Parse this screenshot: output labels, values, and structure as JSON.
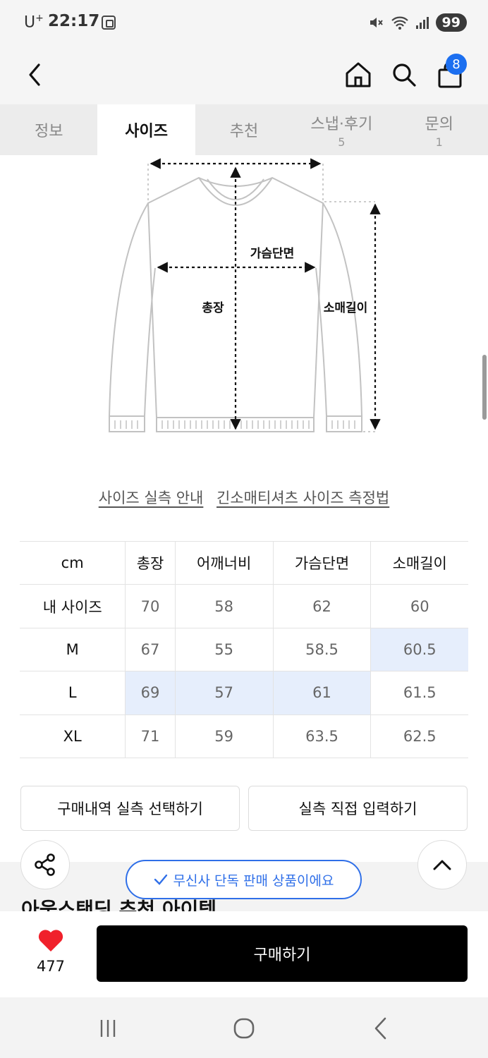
{
  "status_bar": {
    "carrier": "U",
    "carrier_sup": "+",
    "time": "22:17",
    "battery": "99"
  },
  "header": {
    "cart_count": "8"
  },
  "tabs": [
    {
      "label": "정보",
      "count": ""
    },
    {
      "label": "사이즈",
      "count": ""
    },
    {
      "label": "추천",
      "count": ""
    },
    {
      "label": "스냅·후기",
      "count": "5"
    },
    {
      "label": "문의",
      "count": "1"
    }
  ],
  "diagram": {
    "chest": "가슴단면",
    "length": "총장",
    "sleeve": "소매길이"
  },
  "guides": {
    "actual_size": "사이즈 실측 안내",
    "how_to_measure": "긴소매티셔츠 사이즈 측정법"
  },
  "size_table": {
    "headers": [
      "cm",
      "총장",
      "어깨너비",
      "가슴단면",
      "소매길이"
    ],
    "rows": [
      {
        "label": "내 사이즈",
        "values": [
          "70",
          "58",
          "62",
          "60"
        ]
      },
      {
        "label": "M",
        "values": [
          "67",
          "55",
          "58.5",
          "60.5"
        ]
      },
      {
        "label": "L",
        "values": [
          "69",
          "57",
          "61",
          "61.5"
        ]
      },
      {
        "label": "XL",
        "values": [
          "71",
          "59",
          "63.5",
          "62.5"
        ]
      }
    ]
  },
  "actions": {
    "select_history": "구매내역 실측 선택하기",
    "direct_input": "실측 직접 입력하기"
  },
  "exclusive_notice": "무신사 단독 판매 상품이에요",
  "next_section_title": "아웃스탠딩 추천 아이템",
  "bottom": {
    "like_count": "477",
    "buy_label": "구매하기"
  },
  "colors": {
    "accent_blue": "#2f6fe8",
    "highlight": "#e6eefc",
    "heart_red": "#f0212b"
  }
}
